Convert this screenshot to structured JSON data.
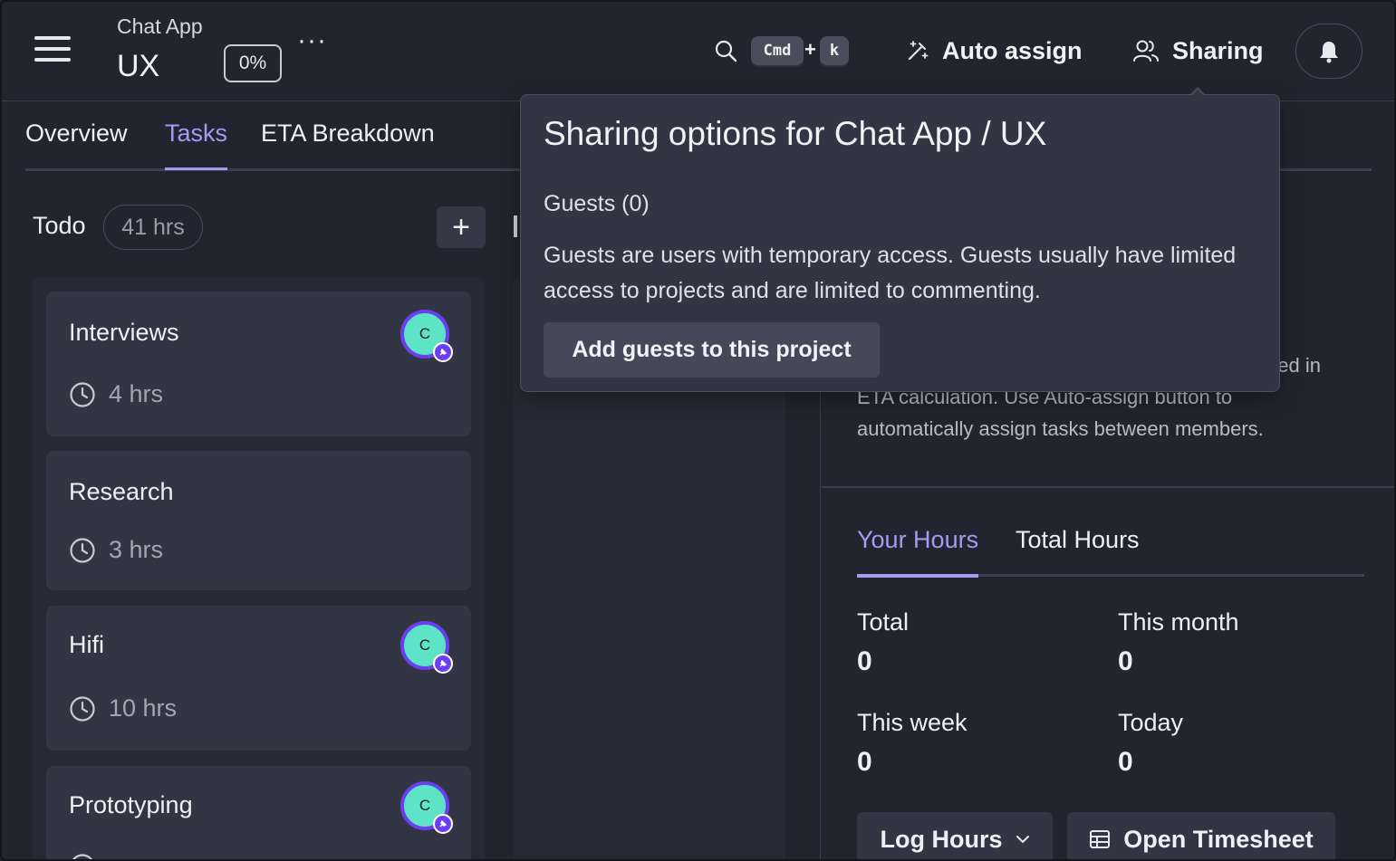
{
  "header": {
    "project_name": "Chat App",
    "section_name": "UX",
    "progress": "0%",
    "more_label": "···",
    "shortcut": {
      "cmd": "Cmd",
      "plus": "+",
      "key": "k"
    },
    "auto_assign_label": "Auto assign",
    "sharing_label": "Sharing"
  },
  "tabs": [
    {
      "label": "Overview",
      "active": false
    },
    {
      "label": "Tasks",
      "active": true
    },
    {
      "label": "ETA Breakdown",
      "active": false
    }
  ],
  "todo": {
    "label": "Todo",
    "hours": "41 hrs",
    "add_label": "+",
    "cards": [
      {
        "title": "Interviews",
        "hours": "4 hrs",
        "assignee": "C"
      },
      {
        "title": "Research",
        "hours": "3 hrs",
        "assignee": null
      },
      {
        "title": "Hifi",
        "hours": "10 hrs",
        "assignee": "C"
      },
      {
        "title": "Prototyping",
        "hours": "",
        "assignee": "C"
      }
    ]
  },
  "right_panel": {
    "partial_text_line1": "ed in",
    "partial_text_line2": "ETA calculation. Use Auto-assign button to",
    "partial_text_line3": "automatically assign tasks between members.",
    "hours_tabs": [
      {
        "label": "Your Hours",
        "active": true
      },
      {
        "label": "Total Hours",
        "active": false
      }
    ],
    "stats": {
      "total_label": "Total",
      "total_value": "0",
      "month_label": "This month",
      "month_value": "0",
      "week_label": "This week",
      "week_value": "0",
      "today_label": "Today",
      "today_value": "0"
    },
    "log_hours_label": "Log Hours",
    "open_timesheet_label": "Open Timesheet"
  },
  "sharing_popover": {
    "title": "Sharing options for Chat App / UX",
    "guests_label": "Guests (0)",
    "description": "Guests are users with temporary access. Guests usually have limited access to projects and are limited to commenting.",
    "add_button_label": "Add guests to this project"
  },
  "colors": {
    "accent": "#a79af0",
    "avatar_bg": "#5de3c6",
    "avatar_ring": "#6b3ff0",
    "background": "#22242f",
    "card": "#323544"
  }
}
